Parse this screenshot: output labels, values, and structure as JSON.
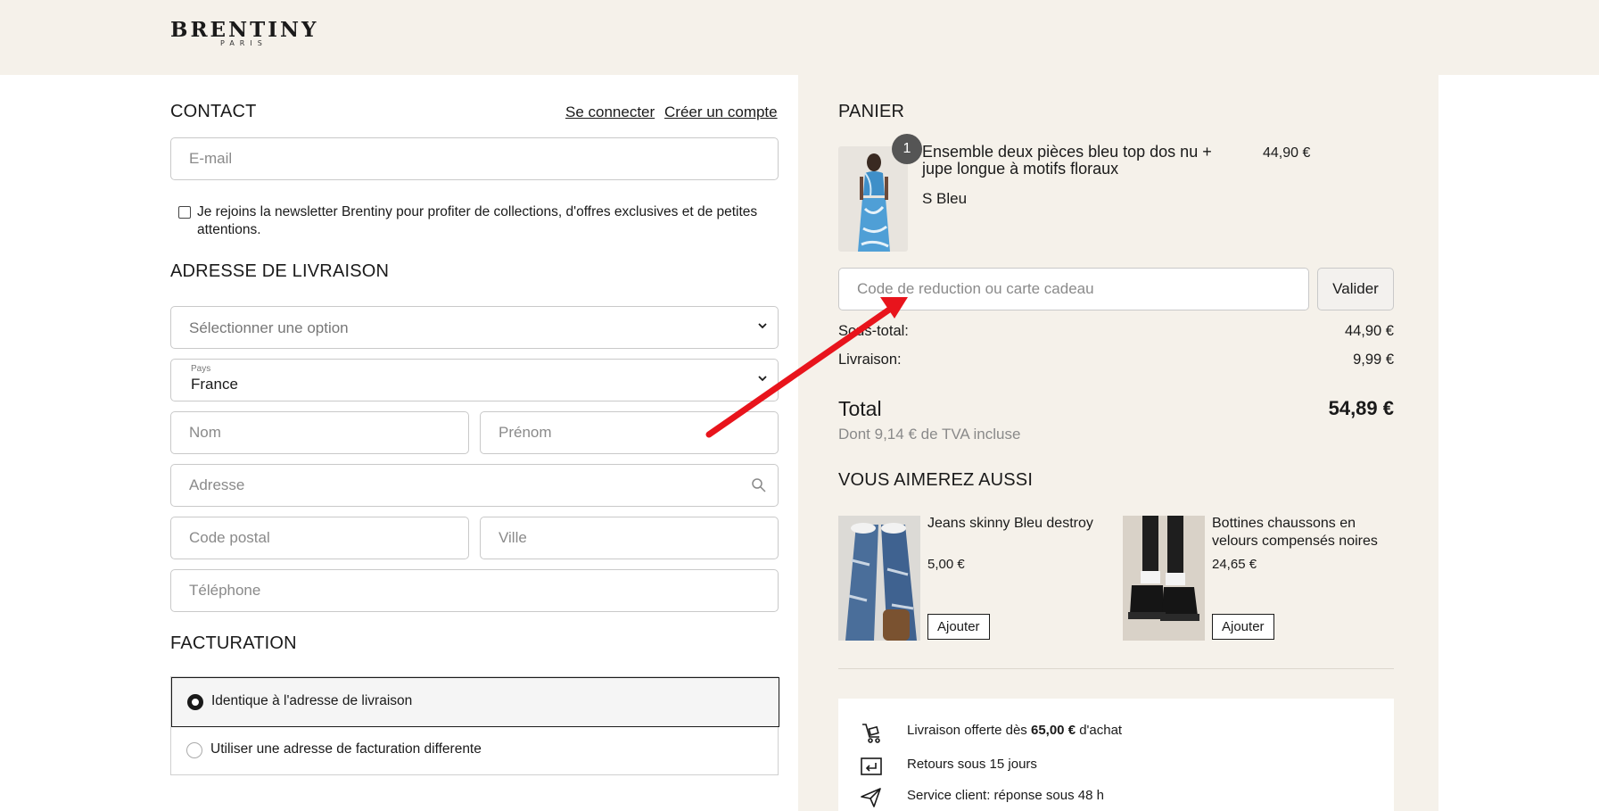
{
  "header": {
    "logo_main": "BRENTINY",
    "logo_sub": "PARIS"
  },
  "contact": {
    "title": "CONTACT",
    "login_link": "Se connecter",
    "create_link": "Créer un compte",
    "email_placeholder": "E-mail",
    "newsletter_text": "Je rejoins la newsletter Brentiny pour profiter de collections, d'offres exclusives et de petites attentions."
  },
  "shipping": {
    "title": "ADRESSE DE LIVRAISON",
    "select_option": "Sélectionner une option",
    "country_label": "Pays",
    "country_value": "France",
    "nom_placeholder": "Nom",
    "prenom_placeholder": "Prénom",
    "adresse_placeholder": "Adresse",
    "postal_placeholder": "Code postal",
    "ville_placeholder": "Ville",
    "telephone_placeholder": "Téléphone"
  },
  "billing": {
    "title": "FACTURATION",
    "option_same": "Identique à l'adresse de livraison",
    "option_different": "Utiliser une adresse de facturation differente"
  },
  "cart": {
    "title": "PANIER",
    "quantity": "1",
    "product_name": "Ensemble deux pièces bleu top dos nu + jupe longue à motifs floraux",
    "product_price": "44,90 €",
    "product_variant": "S Bleu",
    "discount_placeholder": "Code de reduction ou carte cadeau",
    "apply_label": "Valider",
    "subtotal_label": "Sous-total:",
    "subtotal_value": "44,90 €",
    "shipping_label": "Livraison:",
    "shipping_value": "9,99 €",
    "total_label": "Total",
    "total_value": "54,89 €",
    "tva_text": "Dont 9,14 € de TVA incluse"
  },
  "recommendations": {
    "title": "VOUS AIMEREZ AUSSI",
    "items": [
      {
        "name": "Jeans skinny Bleu destroy",
        "price": "5,00 €",
        "button": "Ajouter"
      },
      {
        "name": "Bottines chaussons en velours compensés noires",
        "price": "24,65 €",
        "button": "Ajouter"
      }
    ]
  },
  "perks": [
    {
      "icon": "delivery-cart-icon",
      "text_prefix": "Livraison offerte dès ",
      "text_bold": "65,00 €",
      "text_suffix": " d'achat"
    },
    {
      "icon": "return-icon",
      "text": "Retours sous 15 jours"
    },
    {
      "icon": "paper-plane-icon",
      "text": "Service client: réponse sous 48 h"
    }
  ],
  "colors": {
    "beige": "#f5f1ea",
    "text": "#1a1a1a",
    "annotation_arrow": "#e8141c"
  }
}
